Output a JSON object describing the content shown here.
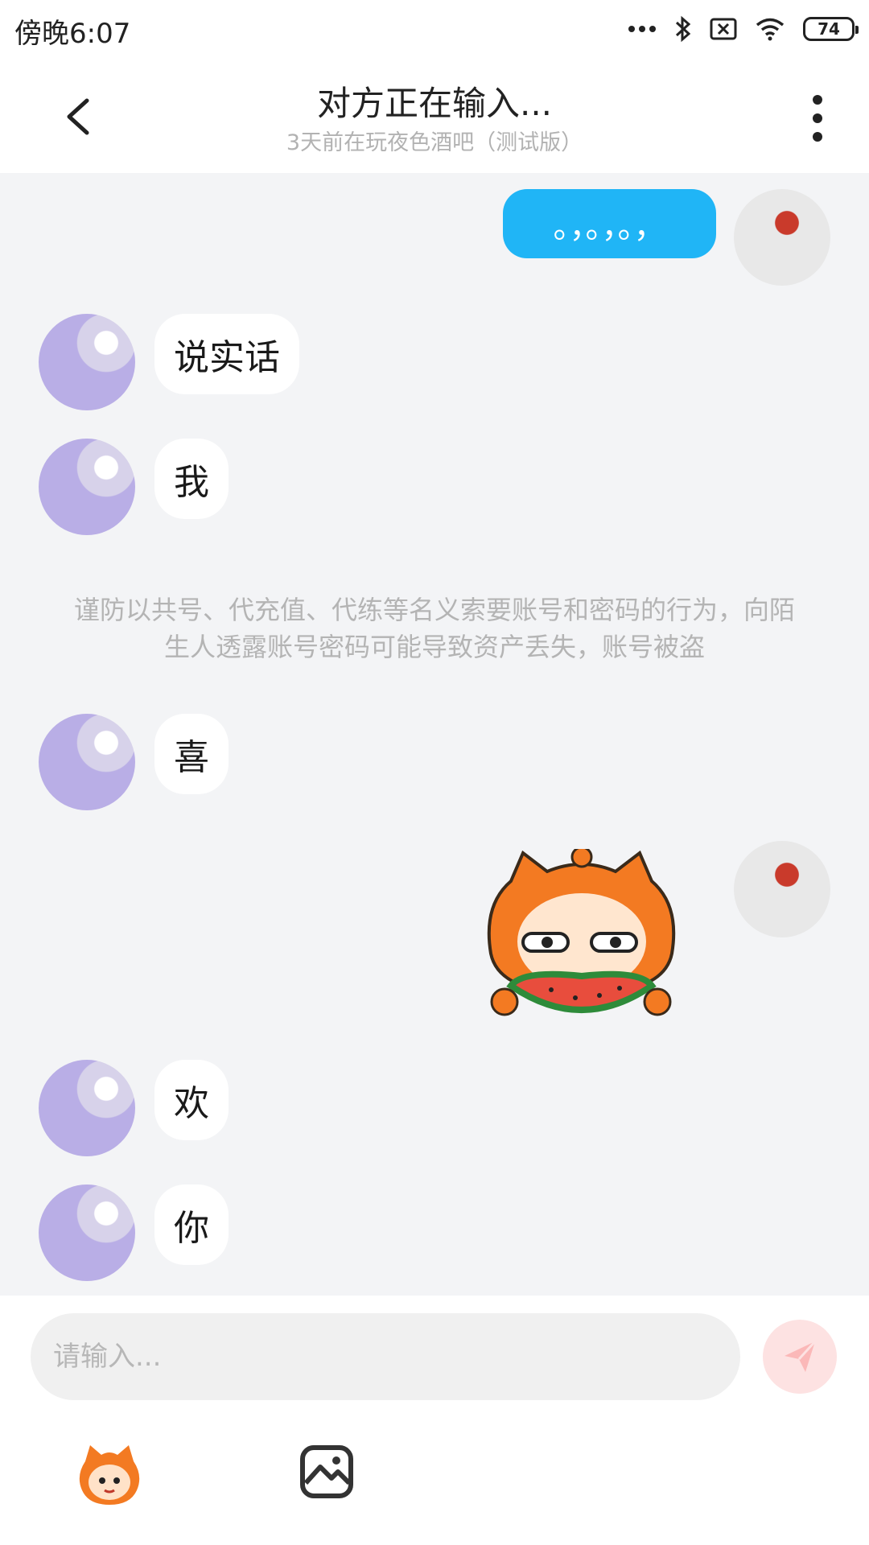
{
  "status_bar": {
    "time": "傍晚6:07",
    "battery": "74",
    "icons": [
      "dots-icon",
      "bluetooth-icon",
      "sim-off-icon",
      "wifi-icon",
      "battery-icon"
    ]
  },
  "header": {
    "title": "对方正在输入...",
    "subtitle": "3天前在玩夜色酒吧（测试版）",
    "back_icon": "back-arrow-icon",
    "more_icon": "more-vertical-icon"
  },
  "messages": [
    {
      "from": "me",
      "text": "。，。，。，"
    },
    {
      "from": "other",
      "text": "说实话"
    },
    {
      "from": "other",
      "text": "我"
    },
    {
      "from": "other",
      "text": "喜"
    },
    {
      "from": "me",
      "sticker": "orange-cat-eating-watermelon"
    },
    {
      "from": "other",
      "text": "欢"
    },
    {
      "from": "other",
      "text": "你"
    }
  ],
  "notice": "谨防以共号、代充值、代练等名义索要账号和密码的行为，向陌生人透露账号密码可能导致资产丢失，账号被盗",
  "composer": {
    "placeholder": "请输入...",
    "send_icon": "paper-plane-icon",
    "tools": [
      "sticker-icon",
      "image-icon"
    ]
  },
  "colors": {
    "outgoing_bubble": "#20b5f6",
    "chat_background": "#f3f4f6",
    "send_button": "#fde2e2"
  }
}
